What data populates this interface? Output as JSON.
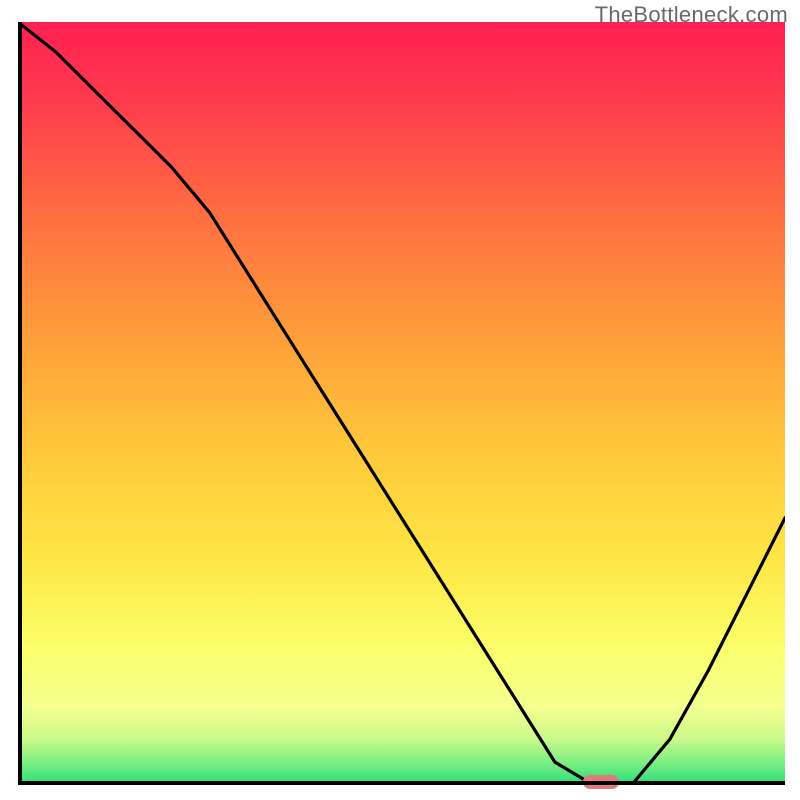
{
  "watermark": "TheBottleneck.com",
  "chart_data": {
    "type": "line",
    "title": "",
    "xlabel": "",
    "ylabel": "",
    "xlim": [
      0,
      100
    ],
    "ylim": [
      0,
      100
    ],
    "x": [
      0,
      5,
      10,
      15,
      20,
      25,
      30,
      35,
      40,
      45,
      50,
      55,
      60,
      65,
      70,
      75,
      80,
      85,
      90,
      95,
      100
    ],
    "values": [
      100,
      96,
      91,
      86,
      81,
      75,
      67,
      59,
      51,
      43,
      35,
      27,
      19,
      11,
      3,
      0,
      0,
      6,
      15,
      25,
      35
    ],
    "marker": {
      "x": 76,
      "y": 0
    },
    "background_gradient": [
      "#ff2a55",
      "#ff9a3c",
      "#ffe642",
      "#f6ff7a",
      "#26e07a"
    ]
  }
}
